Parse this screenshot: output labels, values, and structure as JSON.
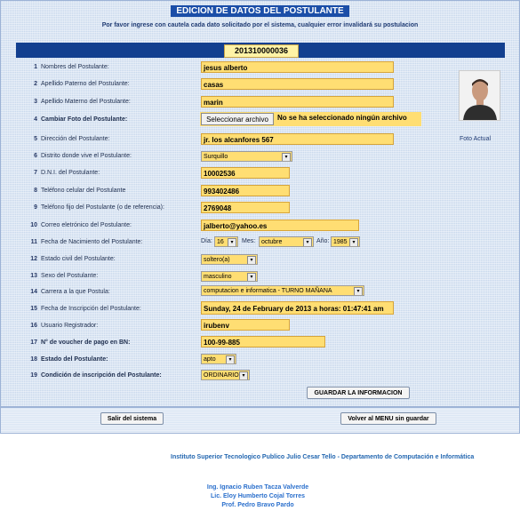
{
  "header": {
    "title": "EDICION DE DATOS DEL POSTULANTE",
    "subtitle": "Por favor ingrese con cautela cada dato solicitado por el sistema, cualquier error invalidará su postulacion",
    "code": "201310000036"
  },
  "rows": [
    {
      "num": "1",
      "label": "Nombres del Postulante:",
      "value": "jesus alberto"
    },
    {
      "num": "2",
      "label": "Apellido Paterno del Postulante:",
      "value": "casas"
    },
    {
      "num": "3",
      "label": "Apellido Materno del Postulante:",
      "value": "marin"
    },
    {
      "num": "4",
      "label": "Cambiar Foto del Postulante:",
      "value": ""
    },
    {
      "num": "5",
      "label": "Dirección del Postulante:",
      "value": "jr. los alcanfores 567"
    },
    {
      "num": "6",
      "label": "Distrito donde vive el Postulante:",
      "value": "Surquillo"
    },
    {
      "num": "7",
      "label": "D.N.I. del Postulante:",
      "value": "10002536"
    },
    {
      "num": "8",
      "label": "Teléfono celular del Postulante",
      "value": "993402486"
    },
    {
      "num": "9",
      "label": "Teléfono fijo del Postulante (o de referencia):",
      "value": "2769048"
    },
    {
      "num": "10",
      "label": "Correo eletrónico del Postulante:",
      "value": "jalberto@yahoo.es"
    },
    {
      "num": "11",
      "label": "Fecha de Nacimiento del Postulante:",
      "value": ""
    },
    {
      "num": "12",
      "label": "Estado civil del Postulante:",
      "value": "soltero(a)"
    },
    {
      "num": "13",
      "label": "Sexo del Postulante:",
      "value": "masculino"
    },
    {
      "num": "14",
      "label": "Carrera a la que Postula:",
      "value": "computacion e informatica - TURNO MAÑANA"
    },
    {
      "num": "15",
      "label": "Fecha de Inscripción del Postulante:",
      "value": "Sunday, 24 de February de 2013 a horas: 01:47:41 am"
    },
    {
      "num": "16",
      "label": "Usuario Registrador:",
      "value": "irubenv"
    },
    {
      "num": "17",
      "label": "N° de voucher de pago en BN:",
      "value": "100-99-885"
    },
    {
      "num": "18",
      "label": "Estado del Postulante:",
      "value": "apto"
    },
    {
      "num": "19",
      "label": "Condición de inscripción del Postulante:",
      "value": "ORDINARIO"
    }
  ],
  "file_input": {
    "button": "Seleccionar archivo",
    "status": "No se ha seleccionado ningún archivo"
  },
  "photo_label": "Foto Actual",
  "birth": {
    "dia_label": "Día:",
    "dia": "16",
    "mes_label": "Mes:",
    "mes": "octubre",
    "anio_label": "Año:",
    "anio": "1985"
  },
  "buttons": {
    "save": "GUARDAR LA INFORMACION",
    "exit": "Salir del sistema",
    "back": "Volver al MENU sin guardar"
  },
  "footer": {
    "institution": "Instituto Superior Tecnologico Publico Julio Cesar Tello - Departamento de Computación e Informática",
    "credits": [
      "Ing. Ignacio Ruben Tacza Valverde",
      "Lic. Eloy Humberto Cojal Torres",
      "Prof. Pedro Bravo Pardo"
    ]
  },
  "colors": {
    "field": "#ffde73",
    "header_bar": "#123f8f",
    "title_bg": "#1b4ea8",
    "link": "#2a6fcc"
  }
}
